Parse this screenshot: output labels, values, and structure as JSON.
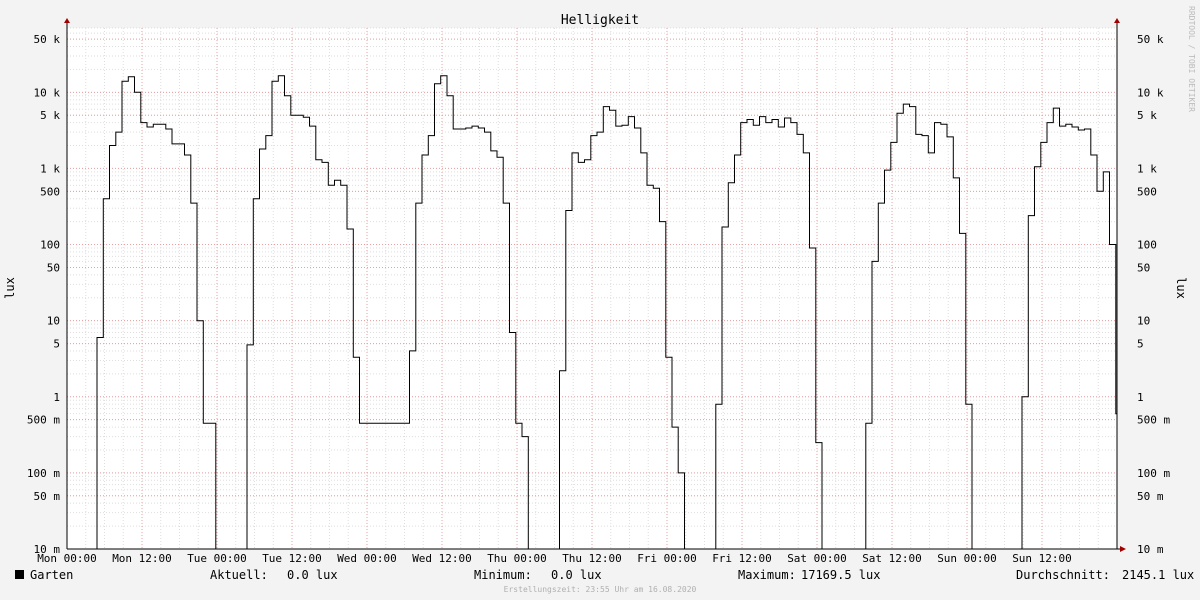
{
  "chart_data": {
    "type": "line",
    "title": "Helligkeit",
    "ylabel": "lux",
    "yscale": "log",
    "ylim": [
      0.01,
      70000
    ],
    "xlim_hours": [
      0,
      168
    ],
    "grid": true,
    "watermark": "RRDTOOL / TOBI OETIKER",
    "x_ticks": [
      {
        "hour": 0,
        "label": "Mon 00:00"
      },
      {
        "hour": 12,
        "label": "Mon 12:00"
      },
      {
        "hour": 24,
        "label": "Tue 00:00"
      },
      {
        "hour": 36,
        "label": "Tue 12:00"
      },
      {
        "hour": 48,
        "label": "Wed 00:00"
      },
      {
        "hour": 60,
        "label": "Wed 12:00"
      },
      {
        "hour": 72,
        "label": "Thu 00:00"
      },
      {
        "hour": 84,
        "label": "Thu 12:00"
      },
      {
        "hour": 96,
        "label": "Fri 00:00"
      },
      {
        "hour": 108,
        "label": "Fri 12:00"
      },
      {
        "hour": 120,
        "label": "Sat 00:00"
      },
      {
        "hour": 132,
        "label": "Sat 12:00"
      },
      {
        "hour": 144,
        "label": "Sun 00:00"
      },
      {
        "hour": 156,
        "label": "Sun 12:00"
      }
    ],
    "y_ticks": [
      {
        "value": 0.01,
        "label": "10 m"
      },
      {
        "value": 0.05,
        "label": "50 m"
      },
      {
        "value": 0.1,
        "label": "100 m"
      },
      {
        "value": 0.5,
        "label": "500 m"
      },
      {
        "value": 1,
        "label": "1"
      },
      {
        "value": 5,
        "label": "5"
      },
      {
        "value": 10,
        "label": "10"
      },
      {
        "value": 50,
        "label": "50"
      },
      {
        "value": 100,
        "label": "100"
      },
      {
        "value": 500,
        "label": "500"
      },
      {
        "value": 1000,
        "label": "1 k"
      },
      {
        "value": 5000,
        "label": "5 k"
      },
      {
        "value": 10000,
        "label": "10 k"
      },
      {
        "value": 50000,
        "label": "50 k"
      }
    ],
    "series": [
      {
        "name": "Garten",
        "color": "#000000",
        "step": true,
        "points": [
          [
            0,
            0.01
          ],
          [
            4.8,
            6
          ],
          [
            5.8,
            400
          ],
          [
            6.8,
            2000
          ],
          [
            7.8,
            3000
          ],
          [
            8.8,
            14000
          ],
          [
            9.8,
            16000
          ],
          [
            10.8,
            10000
          ],
          [
            11.8,
            4000
          ],
          [
            12.8,
            3500
          ],
          [
            13.8,
            3800
          ],
          [
            15.8,
            3300
          ],
          [
            16.8,
            2100
          ],
          [
            18.8,
            1500
          ],
          [
            19.8,
            350
          ],
          [
            20.8,
            10
          ],
          [
            21.8,
            0.45
          ],
          [
            23.8,
            0.01
          ],
          [
            28.8,
            4.8
          ],
          [
            29.8,
            400
          ],
          [
            30.8,
            1800
          ],
          [
            31.8,
            2700
          ],
          [
            32.8,
            14000
          ],
          [
            33.8,
            16500
          ],
          [
            34.8,
            9000
          ],
          [
            35.8,
            5000
          ],
          [
            37.8,
            4700
          ],
          [
            38.8,
            3600
          ],
          [
            39.8,
            1300
          ],
          [
            40.8,
            1200
          ],
          [
            41.8,
            600
          ],
          [
            42.8,
            700
          ],
          [
            43.8,
            600
          ],
          [
            44.8,
            160
          ],
          [
            45.8,
            3.3
          ],
          [
            46.8,
            0.45
          ],
          [
            54.8,
            4
          ],
          [
            55.8,
            350
          ],
          [
            56.8,
            1500
          ],
          [
            57.8,
            2700
          ],
          [
            58.8,
            13000
          ],
          [
            59.8,
            16500
          ],
          [
            60.8,
            9000
          ],
          [
            61.8,
            3300
          ],
          [
            63.8,
            3400
          ],
          [
            64.8,
            3600
          ],
          [
            65.8,
            3400
          ],
          [
            66.8,
            3000
          ],
          [
            67.8,
            1700
          ],
          [
            68.8,
            1400
          ],
          [
            69.8,
            350
          ],
          [
            70.8,
            7
          ],
          [
            71.8,
            0.45
          ],
          [
            72.8,
            0.3
          ],
          [
            73.8,
            0.01
          ],
          [
            78.8,
            2.2
          ],
          [
            79.8,
            280
          ],
          [
            80.8,
            1600
          ],
          [
            81.8,
            1200
          ],
          [
            82.8,
            1300
          ],
          [
            83.8,
            2700
          ],
          [
            84.8,
            3000
          ],
          [
            85.8,
            6500
          ],
          [
            86.8,
            5800
          ],
          [
            87.8,
            3600
          ],
          [
            88.8,
            3700
          ],
          [
            89.8,
            4800
          ],
          [
            90.8,
            3400
          ],
          [
            91.8,
            1600
          ],
          [
            92.8,
            600
          ],
          [
            93.8,
            550
          ],
          [
            94.8,
            200
          ],
          [
            95.8,
            3.3
          ],
          [
            96.8,
            0.4
          ],
          [
            97.8,
            0.1
          ],
          [
            98.8,
            0.01
          ],
          [
            103.8,
            0.8
          ],
          [
            104.8,
            170
          ],
          [
            105.8,
            650
          ],
          [
            106.8,
            1500
          ],
          [
            107.8,
            4000
          ],
          [
            108.8,
            4400
          ],
          [
            109.8,
            3700
          ],
          [
            110.8,
            4800
          ],
          [
            111.8,
            4000
          ],
          [
            112.8,
            4400
          ],
          [
            113.8,
            3500
          ],
          [
            114.8,
            4600
          ],
          [
            115.8,
            4000
          ],
          [
            116.8,
            2800
          ],
          [
            117.8,
            1600
          ],
          [
            118.8,
            90
          ],
          [
            119.8,
            0.25
          ],
          [
            120.8,
            0.01
          ],
          [
            127.8,
            0.45
          ],
          [
            128.8,
            60
          ],
          [
            129.8,
            350
          ],
          [
            130.8,
            950
          ],
          [
            131.8,
            2200
          ],
          [
            132.8,
            5300
          ],
          [
            133.8,
            7000
          ],
          [
            134.8,
            6500
          ],
          [
            135.8,
            2800
          ],
          [
            136.8,
            2700
          ],
          [
            137.8,
            1600
          ],
          [
            138.8,
            4000
          ],
          [
            139.8,
            3800
          ],
          [
            140.8,
            2600
          ],
          [
            141.8,
            750
          ],
          [
            142.8,
            140
          ],
          [
            143.8,
            0.8
          ],
          [
            144.8,
            0.01
          ],
          [
            152.8,
            1
          ],
          [
            153.8,
            240
          ],
          [
            154.8,
            1050
          ],
          [
            155.8,
            2200
          ],
          [
            156.8,
            4000
          ],
          [
            157.8,
            6200
          ],
          [
            158.8,
            3600
          ],
          [
            159.8,
            3800
          ],
          [
            160.8,
            3500
          ],
          [
            161.8,
            3200
          ],
          [
            162.8,
            3300
          ],
          [
            163.8,
            1500
          ],
          [
            164.8,
            500
          ],
          [
            165.8,
            900
          ],
          [
            166.8,
            100
          ],
          [
            167.8,
            0.6
          ],
          [
            168.5,
            0.01
          ]
        ]
      }
    ]
  },
  "legend": {
    "series_name": "Garten",
    "series_color": "#000000",
    "current_label": "Aktuell:",
    "current_value": "0.0 lux",
    "min_label": "Minimum:",
    "min_value": "0.0 lux",
    "max_label": "Maximum:",
    "max_value": "17169.5 lux",
    "avg_label": "Durchschnitt:",
    "avg_value": "2145.1 lux"
  },
  "footer": {
    "created": "Erstellungszeit: 23:55 Uhr am 16.08.2020"
  }
}
